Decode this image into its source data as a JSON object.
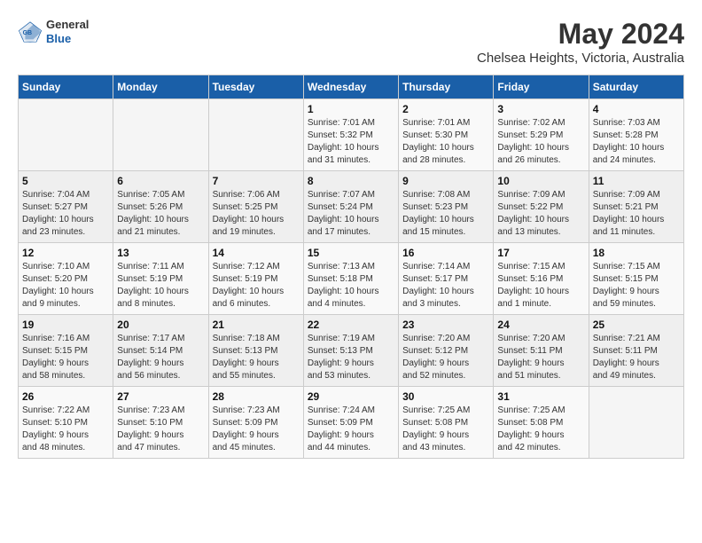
{
  "header": {
    "logo": {
      "general": "General",
      "blue": "Blue"
    },
    "title": "May 2024",
    "subtitle": "Chelsea Heights, Victoria, Australia"
  },
  "calendar": {
    "days_of_week": [
      "Sunday",
      "Monday",
      "Tuesday",
      "Wednesday",
      "Thursday",
      "Friday",
      "Saturday"
    ],
    "weeks": [
      [
        {
          "day": "",
          "detail": ""
        },
        {
          "day": "",
          "detail": ""
        },
        {
          "day": "",
          "detail": ""
        },
        {
          "day": "1",
          "detail": "Sunrise: 7:01 AM\nSunset: 5:32 PM\nDaylight: 10 hours\nand 31 minutes."
        },
        {
          "day": "2",
          "detail": "Sunrise: 7:01 AM\nSunset: 5:30 PM\nDaylight: 10 hours\nand 28 minutes."
        },
        {
          "day": "3",
          "detail": "Sunrise: 7:02 AM\nSunset: 5:29 PM\nDaylight: 10 hours\nand 26 minutes."
        },
        {
          "day": "4",
          "detail": "Sunrise: 7:03 AM\nSunset: 5:28 PM\nDaylight: 10 hours\nand 24 minutes."
        }
      ],
      [
        {
          "day": "5",
          "detail": "Sunrise: 7:04 AM\nSunset: 5:27 PM\nDaylight: 10 hours\nand 23 minutes."
        },
        {
          "day": "6",
          "detail": "Sunrise: 7:05 AM\nSunset: 5:26 PM\nDaylight: 10 hours\nand 21 minutes."
        },
        {
          "day": "7",
          "detail": "Sunrise: 7:06 AM\nSunset: 5:25 PM\nDaylight: 10 hours\nand 19 minutes."
        },
        {
          "day": "8",
          "detail": "Sunrise: 7:07 AM\nSunset: 5:24 PM\nDaylight: 10 hours\nand 17 minutes."
        },
        {
          "day": "9",
          "detail": "Sunrise: 7:08 AM\nSunset: 5:23 PM\nDaylight: 10 hours\nand 15 minutes."
        },
        {
          "day": "10",
          "detail": "Sunrise: 7:09 AM\nSunset: 5:22 PM\nDaylight: 10 hours\nand 13 minutes."
        },
        {
          "day": "11",
          "detail": "Sunrise: 7:09 AM\nSunset: 5:21 PM\nDaylight: 10 hours\nand 11 minutes."
        }
      ],
      [
        {
          "day": "12",
          "detail": "Sunrise: 7:10 AM\nSunset: 5:20 PM\nDaylight: 10 hours\nand 9 minutes."
        },
        {
          "day": "13",
          "detail": "Sunrise: 7:11 AM\nSunset: 5:19 PM\nDaylight: 10 hours\nand 8 minutes."
        },
        {
          "day": "14",
          "detail": "Sunrise: 7:12 AM\nSunset: 5:19 PM\nDaylight: 10 hours\nand 6 minutes."
        },
        {
          "day": "15",
          "detail": "Sunrise: 7:13 AM\nSunset: 5:18 PM\nDaylight: 10 hours\nand 4 minutes."
        },
        {
          "day": "16",
          "detail": "Sunrise: 7:14 AM\nSunset: 5:17 PM\nDaylight: 10 hours\nand 3 minutes."
        },
        {
          "day": "17",
          "detail": "Sunrise: 7:15 AM\nSunset: 5:16 PM\nDaylight: 10 hours\nand 1 minute."
        },
        {
          "day": "18",
          "detail": "Sunrise: 7:15 AM\nSunset: 5:15 PM\nDaylight: 9 hours\nand 59 minutes."
        }
      ],
      [
        {
          "day": "19",
          "detail": "Sunrise: 7:16 AM\nSunset: 5:15 PM\nDaylight: 9 hours\nand 58 minutes."
        },
        {
          "day": "20",
          "detail": "Sunrise: 7:17 AM\nSunset: 5:14 PM\nDaylight: 9 hours\nand 56 minutes."
        },
        {
          "day": "21",
          "detail": "Sunrise: 7:18 AM\nSunset: 5:13 PM\nDaylight: 9 hours\nand 55 minutes."
        },
        {
          "day": "22",
          "detail": "Sunrise: 7:19 AM\nSunset: 5:13 PM\nDaylight: 9 hours\nand 53 minutes."
        },
        {
          "day": "23",
          "detail": "Sunrise: 7:20 AM\nSunset: 5:12 PM\nDaylight: 9 hours\nand 52 minutes."
        },
        {
          "day": "24",
          "detail": "Sunrise: 7:20 AM\nSunset: 5:11 PM\nDaylight: 9 hours\nand 51 minutes."
        },
        {
          "day": "25",
          "detail": "Sunrise: 7:21 AM\nSunset: 5:11 PM\nDaylight: 9 hours\nand 49 minutes."
        }
      ],
      [
        {
          "day": "26",
          "detail": "Sunrise: 7:22 AM\nSunset: 5:10 PM\nDaylight: 9 hours\nand 48 minutes."
        },
        {
          "day": "27",
          "detail": "Sunrise: 7:23 AM\nSunset: 5:10 PM\nDaylight: 9 hours\nand 47 minutes."
        },
        {
          "day": "28",
          "detail": "Sunrise: 7:23 AM\nSunset: 5:09 PM\nDaylight: 9 hours\nand 45 minutes."
        },
        {
          "day": "29",
          "detail": "Sunrise: 7:24 AM\nSunset: 5:09 PM\nDaylight: 9 hours\nand 44 minutes."
        },
        {
          "day": "30",
          "detail": "Sunrise: 7:25 AM\nSunset: 5:08 PM\nDaylight: 9 hours\nand 43 minutes."
        },
        {
          "day": "31",
          "detail": "Sunrise: 7:25 AM\nSunset: 5:08 PM\nDaylight: 9 hours\nand 42 minutes."
        },
        {
          "day": "",
          "detail": ""
        }
      ]
    ]
  }
}
